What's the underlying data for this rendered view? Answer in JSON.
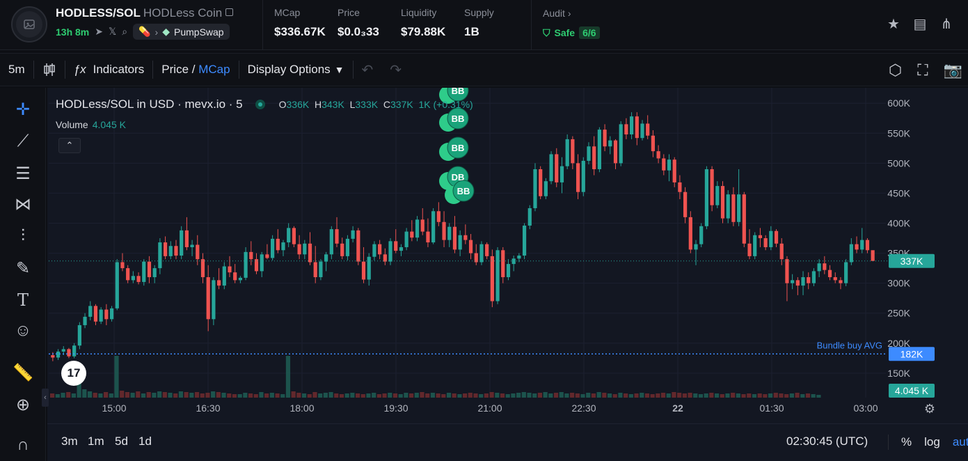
{
  "header": {
    "pair": "HODLESS/SOL",
    "coin_name": "HODLess Coin",
    "age": "13h 8m",
    "dex": "PumpSwap",
    "stats": [
      {
        "label": "MCap",
        "value": "$336.67K"
      },
      {
        "label": "Price",
        "value": "$0.0₃33"
      },
      {
        "label": "Liquidity",
        "value": "$79.88K"
      },
      {
        "label": "Supply",
        "value": "1B"
      }
    ],
    "audit_label": "Audit",
    "safe_label": "Safe",
    "safe_count": "6/6"
  },
  "toolbar": {
    "interval": "5m",
    "indicators": "Indicators",
    "price_label": "Price",
    "divider": "/",
    "mcap_label": "MCap",
    "display_options": "Display Options"
  },
  "chart_legend": {
    "title": "HODLess/SOL in USD · mevx.io · 5",
    "o_label": "O",
    "o": "336K",
    "h_label": "H",
    "h": "343K",
    "l_label": "L",
    "l": "333K",
    "c_label": "C",
    "c": "337K",
    "change": "1K (+0.31%)",
    "volume_label": "Volume",
    "volume_value": "4.045 K"
  },
  "bottombar": {
    "timeframes": [
      "3m",
      "1m",
      "5d",
      "1d"
    ],
    "clock": "02:30:45 (UTC)",
    "percent": "%",
    "log": "log",
    "auto": "auto"
  },
  "chart_data": {
    "type": "candlestick",
    "y_ticks": [
      "600K",
      "550K",
      "500K",
      "450K",
      "400K",
      "350K",
      "300K",
      "250K",
      "200K",
      "150K"
    ],
    "x_ticks": [
      "15:00",
      "16:30",
      "18:00",
      "19:30",
      "21:00",
      "22:30",
      "22",
      "01:30",
      "03:00"
    ],
    "ylim": [
      115,
      620
    ],
    "last_price_label": "337K",
    "last_price": 337,
    "bundle_label": "Bundle buy AVG",
    "bundle_value": 182,
    "bundle_value_label": "182K",
    "volume_badge": "4.045 K",
    "markers": [
      {
        "label": "BB"
      },
      {
        "label": "BB"
      },
      {
        "label": "BB"
      },
      {
        "label": "DB"
      },
      {
        "label": "BB"
      }
    ],
    "colors": {
      "up": "#26a69a",
      "down": "#ef5350",
      "bundle": "#3d8bff",
      "background": "#131722"
    },
    "candles": [
      [
        180,
        185,
        170,
        176
      ],
      [
        176,
        190,
        172,
        186
      ],
      [
        186,
        195,
        180,
        190
      ],
      [
        190,
        192,
        175,
        178
      ],
      [
        178,
        200,
        175,
        196
      ],
      [
        196,
        235,
        190,
        230
      ],
      [
        230,
        250,
        225,
        244
      ],
      [
        244,
        270,
        238,
        262
      ],
      [
        262,
        265,
        230,
        236
      ],
      [
        236,
        260,
        232,
        256
      ],
      [
        256,
        265,
        230,
        240
      ],
      [
        240,
        262,
        236,
        258
      ],
      [
        258,
        340,
        255,
        335
      ],
      [
        335,
        350,
        320,
        325
      ],
      [
        325,
        330,
        300,
        305
      ],
      [
        305,
        320,
        300,
        312
      ],
      [
        312,
        318,
        298,
        302
      ],
      [
        302,
        340,
        296,
        336
      ],
      [
        336,
        345,
        300,
        310
      ],
      [
        310,
        330,
        300,
        325
      ],
      [
        325,
        375,
        315,
        368
      ],
      [
        368,
        378,
        340,
        345
      ],
      [
        345,
        370,
        340,
        362
      ],
      [
        362,
        372,
        340,
        346
      ],
      [
        346,
        395,
        340,
        388
      ],
      [
        388,
        410,
        355,
        360
      ],
      [
        360,
        372,
        345,
        364
      ],
      [
        364,
        380,
        330,
        340
      ],
      [
        340,
        350,
        300,
        310
      ],
      [
        310,
        330,
        220,
        240
      ],
      [
        240,
        310,
        230,
        305
      ],
      [
        305,
        325,
        290,
        296
      ],
      [
        296,
        335,
        290,
        328
      ],
      [
        328,
        345,
        310,
        318
      ],
      [
        318,
        332,
        300,
        305
      ],
      [
        305,
        312,
        300,
        309
      ],
      [
        309,
        360,
        305,
        352
      ],
      [
        352,
        370,
        330,
        340
      ],
      [
        340,
        350,
        315,
        320
      ],
      [
        320,
        352,
        310,
        348
      ],
      [
        348,
        365,
        340,
        342
      ],
      [
        342,
        380,
        338,
        374
      ],
      [
        374,
        390,
        350,
        355
      ],
      [
        355,
        372,
        345,
        368
      ],
      [
        368,
        400,
        360,
        392
      ],
      [
        392,
        395,
        360,
        365
      ],
      [
        365,
        380,
        340,
        348
      ],
      [
        348,
        372,
        340,
        366
      ],
      [
        366,
        385,
        330,
        335
      ],
      [
        335,
        362,
        300,
        310
      ],
      [
        310,
        340,
        305,
        336
      ],
      [
        336,
        352,
        320,
        348
      ],
      [
        348,
        395,
        340,
        390
      ],
      [
        390,
        410,
        360,
        366
      ],
      [
        366,
        376,
        340,
        345
      ],
      [
        345,
        380,
        338,
        374
      ],
      [
        374,
        395,
        368,
        388
      ],
      [
        388,
        392,
        330,
        336
      ],
      [
        336,
        360,
        300,
        306
      ],
      [
        306,
        350,
        296,
        344
      ],
      [
        344,
        370,
        338,
        365
      ],
      [
        365,
        372,
        340,
        348
      ],
      [
        348,
        358,
        330,
        336
      ],
      [
        336,
        375,
        330,
        370
      ],
      [
        370,
        390,
        350,
        354
      ],
      [
        354,
        365,
        345,
        360
      ],
      [
        360,
        392,
        355,
        386
      ],
      [
        386,
        405,
        370,
        376
      ],
      [
        376,
        412,
        370,
        406
      ],
      [
        406,
        425,
        380,
        386
      ],
      [
        386,
        408,
        360,
        368
      ],
      [
        368,
        425,
        365,
        420
      ],
      [
        420,
        435,
        395,
        402
      ],
      [
        402,
        420,
        360,
        372
      ],
      [
        372,
        400,
        360,
        394
      ],
      [
        394,
        412,
        350,
        356
      ],
      [
        356,
        388,
        345,
        380
      ],
      [
        380,
        398,
        365,
        372
      ],
      [
        372,
        382,
        340,
        350
      ],
      [
        350,
        365,
        330,
        335
      ],
      [
        335,
        370,
        330,
        365
      ],
      [
        365,
        368,
        340,
        345
      ],
      [
        345,
        356,
        260,
        270
      ],
      [
        270,
        360,
        265,
        355
      ],
      [
        355,
        360,
        300,
        310
      ],
      [
        310,
        340,
        305,
        332
      ],
      [
        332,
        346,
        320,
        341
      ],
      [
        341,
        350,
        335,
        346
      ],
      [
        346,
        400,
        340,
        396
      ],
      [
        396,
        430,
        390,
        425
      ],
      [
        425,
        500,
        420,
        490
      ],
      [
        490,
        495,
        440,
        445
      ],
      [
        445,
        475,
        440,
        470
      ],
      [
        470,
        520,
        465,
        515
      ],
      [
        515,
        525,
        460,
        468
      ],
      [
        468,
        510,
        450,
        495
      ],
      [
        495,
        548,
        490,
        540
      ],
      [
        540,
        545,
        490,
        500
      ],
      [
        500,
        515,
        440,
        452
      ],
      [
        452,
        510,
        445,
        504
      ],
      [
        504,
        535,
        498,
        528
      ],
      [
        528,
        545,
        480,
        490
      ],
      [
        490,
        560,
        485,
        556
      ],
      [
        556,
        565,
        520,
        528
      ],
      [
        528,
        545,
        515,
        538
      ],
      [
        538,
        540,
        490,
        500
      ],
      [
        500,
        570,
        495,
        565
      ],
      [
        565,
        575,
        540,
        548
      ],
      [
        548,
        585,
        540,
        578
      ],
      [
        578,
        585,
        530,
        542
      ],
      [
        542,
        572,
        538,
        566
      ],
      [
        566,
        580,
        540,
        546
      ],
      [
        546,
        555,
        510,
        520
      ],
      [
        520,
        530,
        500,
        508
      ],
      [
        508,
        515,
        480,
        488
      ],
      [
        488,
        515,
        470,
        506
      ],
      [
        506,
        510,
        460,
        468
      ],
      [
        468,
        480,
        440,
        452
      ],
      [
        452,
        460,
        400,
        410
      ],
      [
        410,
        420,
        350,
        356
      ],
      [
        356,
        372,
        330,
        365
      ],
      [
        365,
        400,
        360,
        395
      ],
      [
        395,
        495,
        390,
        490
      ],
      [
        490,
        495,
        420,
        430
      ],
      [
        430,
        470,
        425,
        462
      ],
      [
        462,
        470,
        400,
        408
      ],
      [
        408,
        455,
        400,
        448
      ],
      [
        448,
        460,
        395,
        402
      ],
      [
        402,
        490,
        395,
        448
      ],
      [
        448,
        452,
        360,
        366
      ],
      [
        366,
        390,
        340,
        345
      ],
      [
        345,
        385,
        340,
        380
      ],
      [
        380,
        392,
        360,
        375
      ],
      [
        375,
        380,
        355,
        360
      ],
      [
        360,
        395,
        355,
        387
      ],
      [
        387,
        390,
        360,
        366
      ],
      [
        366,
        375,
        330,
        340
      ],
      [
        340,
        345,
        270,
        300
      ],
      [
        300,
        315,
        290,
        305
      ],
      [
        305,
        310,
        280,
        296
      ],
      [
        296,
        320,
        280,
        310
      ],
      [
        310,
        318,
        290,
        300
      ],
      [
        300,
        325,
        295,
        320
      ],
      [
        320,
        340,
        310,
        333
      ],
      [
        333,
        345,
        315,
        322
      ],
      [
        322,
        330,
        305,
        310
      ],
      [
        310,
        318,
        300,
        305
      ],
      [
        305,
        310,
        290,
        300
      ],
      [
        300,
        340,
        295,
        335
      ],
      [
        335,
        375,
        330,
        365
      ],
      [
        365,
        378,
        350,
        356
      ],
      [
        356,
        392,
        350,
        372
      ],
      [
        372,
        375,
        350,
        355
      ],
      [
        355,
        345,
        340,
        337
      ]
    ],
    "volumes": [
      6,
      5,
      7,
      8,
      6,
      35,
      12,
      9,
      7,
      6,
      8,
      6,
      60,
      10,
      8,
      7,
      9,
      6,
      8,
      7,
      9,
      8,
      7,
      6,
      9,
      8,
      7,
      8,
      6,
      7,
      9,
      8,
      7,
      6,
      5,
      5,
      7,
      6,
      5,
      8,
      6,
      7,
      6,
      5,
      60,
      9,
      7,
      6,
      5,
      8,
      6,
      7,
      8,
      6,
      5,
      6,
      7,
      6,
      5,
      6,
      7,
      5,
      6,
      7,
      6,
      5,
      7,
      6,
      7,
      8,
      6,
      7,
      6,
      5,
      7,
      6,
      5,
      6,
      7,
      6,
      5,
      6,
      8,
      7,
      6,
      5,
      6,
      7,
      8,
      7,
      6,
      7,
      8,
      6,
      7,
      8,
      6,
      7,
      6,
      5,
      7,
      6,
      8,
      7,
      6,
      5,
      7,
      6,
      5,
      6,
      7,
      6,
      5,
      6,
      7,
      6,
      8,
      7,
      6,
      7,
      6,
      5,
      6,
      7,
      6,
      5,
      6,
      7,
      6,
      5,
      6,
      5,
      6,
      5,
      6,
      7,
      6,
      5,
      6,
      7,
      5,
      6,
      5,
      4
    ]
  }
}
